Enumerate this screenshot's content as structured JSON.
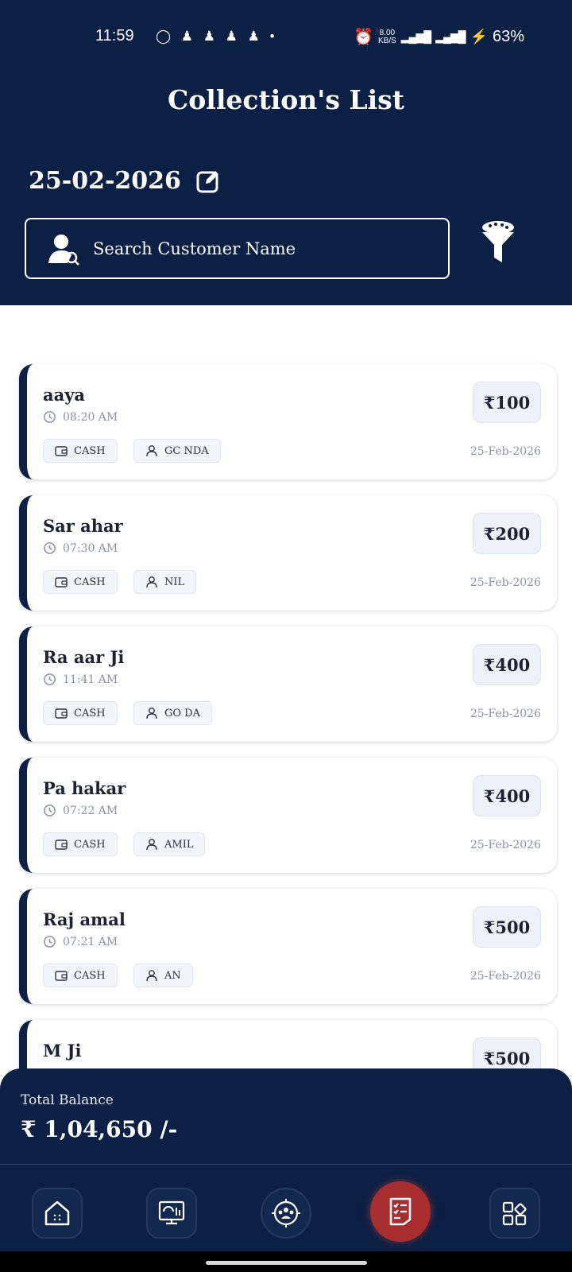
{
  "status_bar": {
    "time": "11:59",
    "left_icons": "◯ ♟ ♟ ♟ ♟ •",
    "net_speed": "8.00",
    "net_unit": "KB/S",
    "battery": "63%"
  },
  "header": {
    "title": "Collection's List",
    "date": "25-02-2026"
  },
  "search": {
    "placeholder": "Search Customer Name"
  },
  "cards": [
    {
      "name": "aaya",
      "time": "08:20 AM",
      "payment": "CASH",
      "agent": "GC   NDA",
      "amount": "₹100",
      "date": "25-Feb-2026"
    },
    {
      "name": "Sar       ahar",
      "time": "07:30 AM",
      "payment": "CASH",
      "agent": "NIL",
      "amount": "₹200",
      "date": "25-Feb-2026"
    },
    {
      "name": "Ra      aar Ji",
      "time": "11:41 AM",
      "payment": "CASH",
      "agent": "GO      DA",
      "amount": "₹400",
      "date": "25-Feb-2026"
    },
    {
      "name": "Pa        hakar",
      "time": "07:22 AM",
      "payment": "CASH",
      "agent": "AMIL",
      "amount": "₹400",
      "date": "25-Feb-2026"
    },
    {
      "name": "Raj             amal",
      "time": "07:21 AM",
      "payment": "CASH",
      "agent": "AN",
      "amount": "₹500",
      "date": "25-Feb-2026"
    },
    {
      "name": "M          Ji",
      "time": "",
      "payment": "",
      "agent": "",
      "amount": "₹500",
      "date": ""
    }
  ],
  "footer": {
    "balance_label": "Total Balance",
    "balance_value": "₹ 1,04,650 /-"
  },
  "nav": {
    "items": [
      "home-icon",
      "dashboard-icon",
      "customers-icon",
      "collection-list-icon",
      "more-apps-icon"
    ],
    "active": "collection-list-icon"
  },
  "colors": {
    "primary": "#0c1f44",
    "active_nav": "#a92e2f",
    "card_border": "#0c1f44"
  }
}
